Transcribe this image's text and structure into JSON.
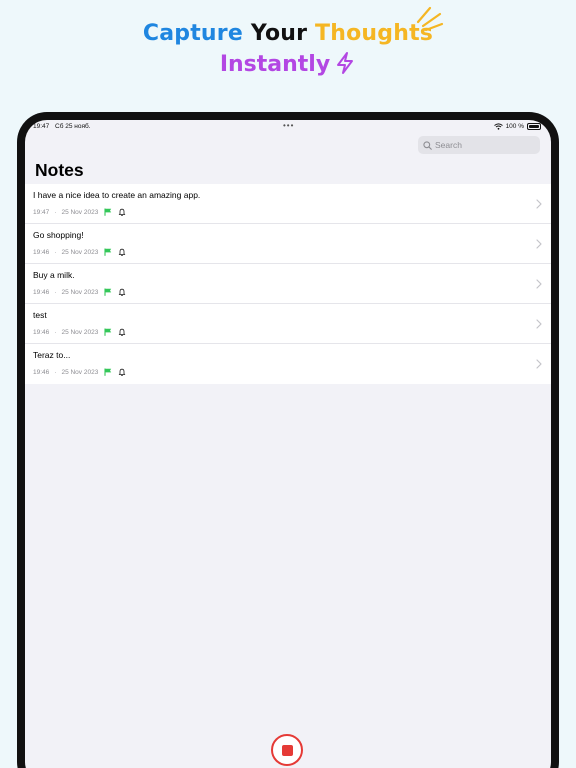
{
  "headline": {
    "line1": [
      {
        "text": "Capture",
        "color": "#1f86e0"
      },
      {
        "text": "Your",
        "color": "#111111"
      },
      {
        "text": "Thoughts",
        "color": "#f5b623"
      }
    ],
    "line2": {
      "text": "Instantly",
      "color": "#b347e3"
    },
    "icons": [
      "spark-lines-icon",
      "lightning-bolt-icon"
    ]
  },
  "status_bar": {
    "time": "19:47",
    "date": "Сб 25 нояб.",
    "dots": "•••",
    "battery": "100 %"
  },
  "search": {
    "placeholder": "Search"
  },
  "page_title": "Notes",
  "notes": [
    {
      "title": "I have a nice idea to create an amazing app.",
      "time": "19:47",
      "date": "25 Nov 2023"
    },
    {
      "title": "Go shopping!",
      "time": "19:46",
      "date": "25 Nov 2023"
    },
    {
      "title": "Buy a milk.",
      "time": "19:46",
      "date": "25 Nov 2023"
    },
    {
      "title": "test",
      "time": "19:46",
      "date": "25 Nov 2023"
    },
    {
      "title": "Teraz to...",
      "time": "19:46",
      "date": "25 Nov 2023"
    }
  ],
  "meta_separator": "·",
  "colors": {
    "accent_flag": "#34c759",
    "record": "#e53a36",
    "background": "#eef8fb"
  }
}
